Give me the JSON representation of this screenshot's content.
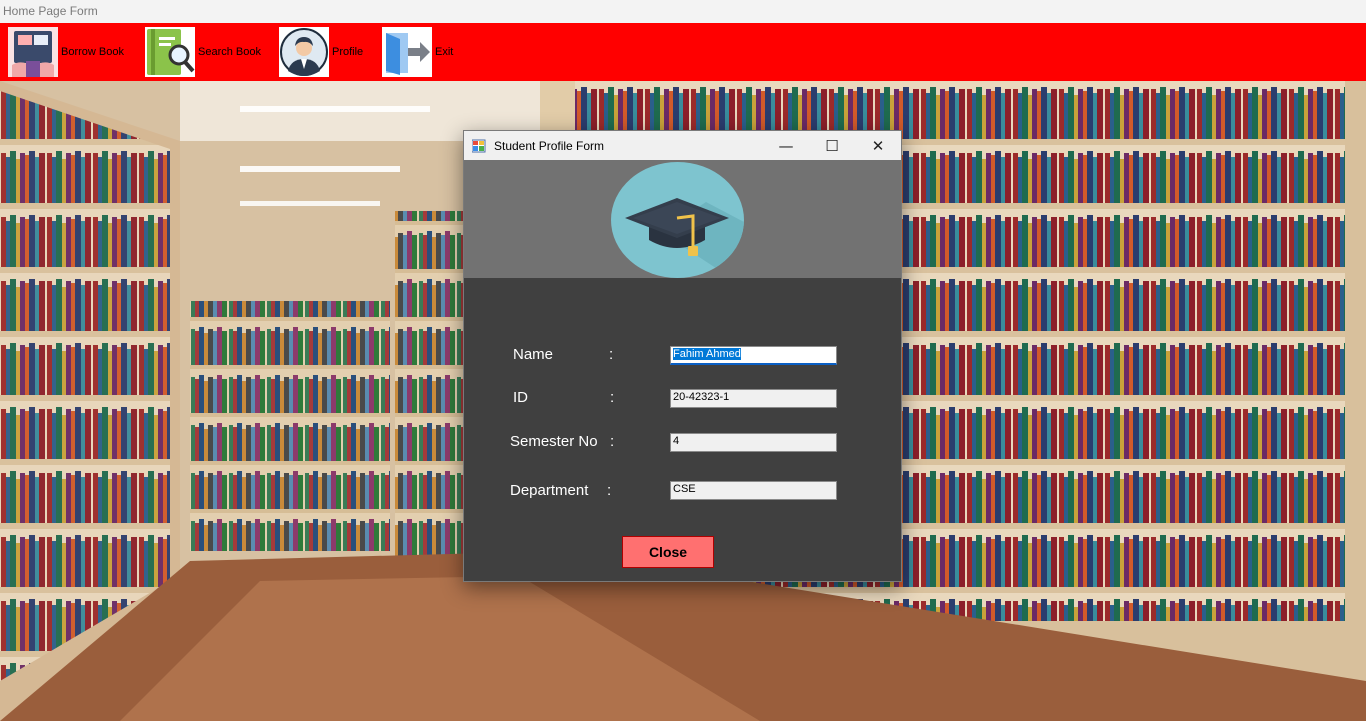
{
  "window": {
    "title": "Home Page Form"
  },
  "toolbar": {
    "items": [
      {
        "label": "Borrow Book",
        "icon": "borrow-book-icon"
      },
      {
        "label": "Search Book",
        "icon": "search-book-icon"
      },
      {
        "label": "Profile",
        "icon": "profile-icon"
      },
      {
        "label": "Exit",
        "icon": "exit-icon"
      }
    ],
    "color": "#ff0000"
  },
  "dialog": {
    "title": "Student Profile Form",
    "controls": {
      "minimize": "—",
      "maximize": "☐",
      "close": "✕"
    },
    "header_icon": "graduation-cap-icon",
    "fields": [
      {
        "label": "Name",
        "value": "Fahim Ahmed"
      },
      {
        "label": "ID",
        "value": "20-42323-1"
      },
      {
        "label": "Semester No",
        "value": "4"
      },
      {
        "label": "Department",
        "value": "CSE"
      }
    ],
    "colon": ":",
    "close_label": "Close",
    "close_color": "#ff7070"
  }
}
